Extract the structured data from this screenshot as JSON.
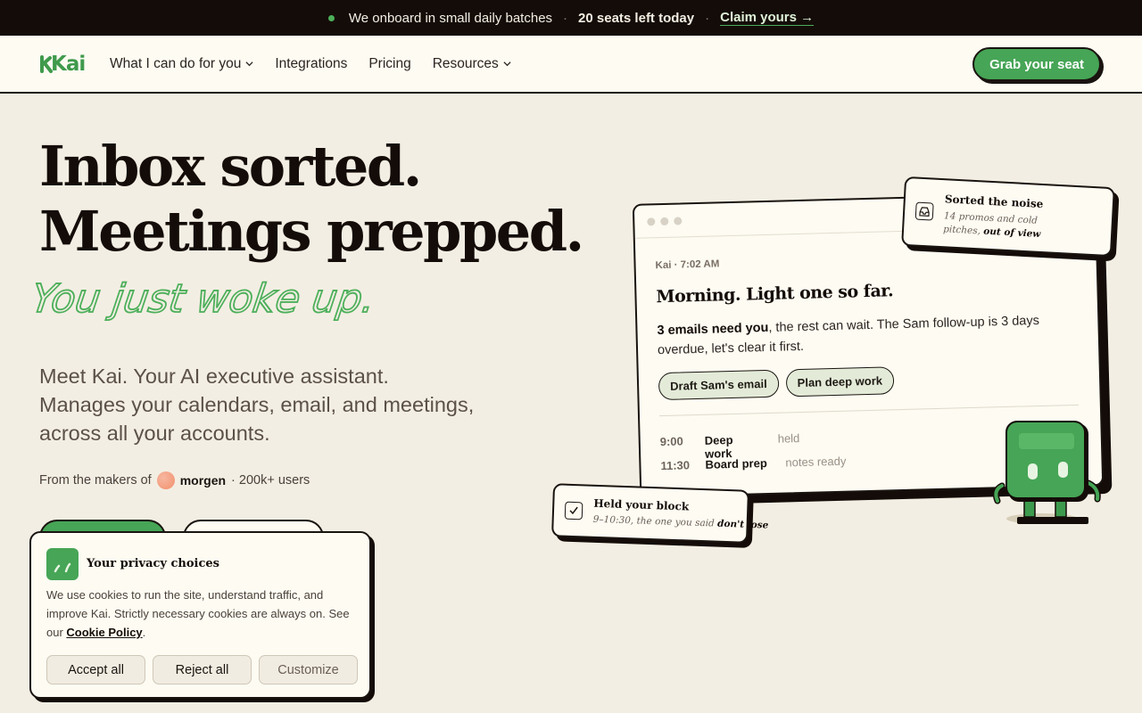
{
  "announcement": {
    "text": "We onboard in small daily batches",
    "seats": "20 seats left today",
    "link": "Claim yours →"
  },
  "nav": {
    "logo": "Kai",
    "items": [
      {
        "label": "What I can do for you",
        "dropdown": true
      },
      {
        "label": "Integrations",
        "dropdown": false
      },
      {
        "label": "Pricing",
        "dropdown": false
      },
      {
        "label": "Resources",
        "dropdown": true
      }
    ],
    "cta": "Grab your seat"
  },
  "hero": {
    "headline_line1": "Inbox sorted.",
    "headline_line2": "Meetings prepped.",
    "script": "You just woke up.",
    "sub_line1": "Meet Kai. Your AI executive assistant.",
    "sub_line2": "Manages your calendars, email, and meetings,",
    "sub_line3": "across all your accounts.",
    "makers_prefix": "From the makers of",
    "makers_brand": "morgen",
    "makers_users": "· 200k+ users"
  },
  "mock": {
    "meta": "Kai · 7:02 AM",
    "title": "Morning. Light one so far.",
    "msg_bold": "3 emails need you",
    "msg_rest": ", the rest can wait. The Sam follow-up is 3 days overdue, let's clear it first.",
    "chips": [
      "Draft Sam's email",
      "Plan deep work"
    ],
    "schedule": [
      {
        "time": "9:00",
        "what": "Deep work",
        "note": "held"
      },
      {
        "time": "11:30",
        "what": "Board prep",
        "note": "notes ready"
      }
    ]
  },
  "card_noise": {
    "title": "Sorted the noise",
    "body_line1": "14 promos and cold",
    "body_line2_pre": "pitches, ",
    "body_line2_bold": "out of view"
  },
  "card_block": {
    "title": "Held your block",
    "body_pre": "9–10:30, the one you said ",
    "body_bold": "don't lose"
  },
  "cookie": {
    "title": "Your privacy choices",
    "text_pre": "We use cookies to run the site, understand traffic, and improve Kai. Strictly necessary cookies are always on. See our ",
    "link": "Cookie Policy",
    "text_post": ".",
    "accept": "Accept all",
    "reject": "Reject all",
    "customize": "Customize"
  },
  "colors": {
    "accent": "#46a556",
    "dark": "#140c08",
    "page_bg": "#f3eee3",
    "panel_bg": "#fdfbf2"
  }
}
